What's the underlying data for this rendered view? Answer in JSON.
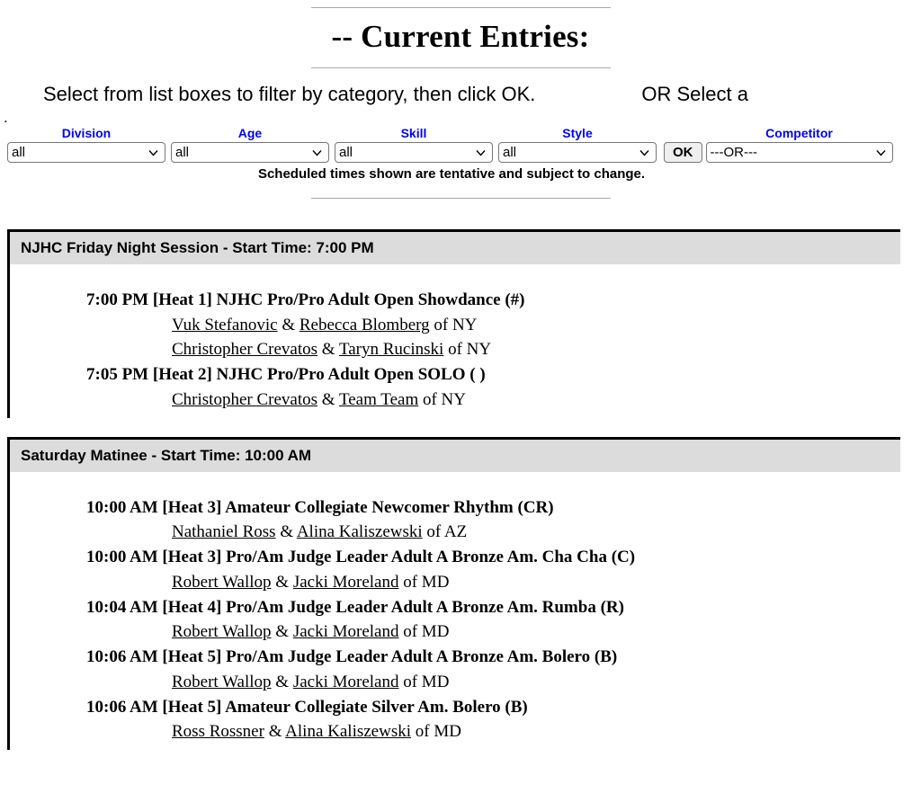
{
  "header": {
    "title": "-- Current Entries:",
    "instructions": "Select from list boxes to filter by category, then click OK.",
    "or_select": "OR Select a",
    "stray_dot": ".",
    "note": "Scheduled times shown are tentative and subject to change."
  },
  "filters": [
    {
      "label": "Division",
      "value": "all",
      "name": "division"
    },
    {
      "label": "Age",
      "value": "all",
      "name": "age"
    },
    {
      "label": "Skill",
      "value": "all",
      "name": "skill"
    },
    {
      "label": "Style",
      "value": "all",
      "name": "style"
    },
    {
      "label": "Competitor",
      "value": "---OR---",
      "name": "competitor"
    }
  ],
  "ok_button": "OK",
  "colors": {
    "label_blue": "#0000ff",
    "session_header_gray": "#dcdcdc",
    "rule_gray": "#a8a8a8",
    "border_black": "#000000",
    "button_face": "#efefef"
  },
  "sessions": [
    {
      "header": "NJHC Friday Night Session - Start Time: 7:00 PM",
      "heats": [
        {
          "title": "7:00 PM [Heat 1] NJHC Pro/Pro Adult Open Showdance (#)",
          "entries": [
            {
              "leader": "Vuk Stefanovic",
              "amp": "&",
              "follower": "Rebecca Blomberg",
              "of": "of NY"
            },
            {
              "leader": "Christopher Crevatos",
              "amp": "&",
              "follower": "Taryn Rucinski",
              "of": "of NY"
            }
          ]
        },
        {
          "title": "7:05 PM [Heat 2] NJHC Pro/Pro Adult Open SOLO ( )",
          "entries": [
            {
              "leader": "Christopher Crevatos",
              "amp": "&",
              "follower": "Team Team",
              "of": "of NY"
            }
          ]
        }
      ]
    },
    {
      "header": "Saturday Matinee - Start Time: 10:00 AM",
      "heats": [
        {
          "title": "10:00 AM [Heat 3] Amateur Collegiate Newcomer Rhythm (CR)",
          "entries": [
            {
              "leader": "Nathaniel Ross",
              "amp": "&",
              "follower": "Alina Kaliszewski",
              "of": "of AZ"
            }
          ]
        },
        {
          "title": "10:00 AM [Heat 3] Pro/Am Judge Leader Adult A Bronze Am. Cha Cha (C)",
          "entries": [
            {
              "leader": "Robert Wallop",
              "amp": "&",
              "follower": "Jacki Moreland",
              "of": "of MD"
            }
          ]
        },
        {
          "title": "10:04 AM [Heat 4] Pro/Am Judge Leader Adult A Bronze Am. Rumba (R)",
          "entries": [
            {
              "leader": "Robert Wallop",
              "amp": "&",
              "follower": "Jacki Moreland",
              "of": "of MD"
            }
          ]
        },
        {
          "title": "10:06 AM [Heat 5] Pro/Am Judge Leader Adult A Bronze Am. Bolero (B)",
          "entries": [
            {
              "leader": "Robert Wallop",
              "amp": "&",
              "follower": "Jacki Moreland",
              "of": "of MD"
            }
          ]
        },
        {
          "title": "10:06 AM [Heat 5] Amateur Collegiate Silver Am. Bolero (B)",
          "entries": [
            {
              "leader": "Ross Rossner",
              "amp": "&",
              "follower": "Alina Kaliszewski",
              "of": "of MD"
            }
          ]
        }
      ]
    }
  ]
}
